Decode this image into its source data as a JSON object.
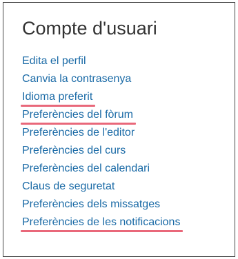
{
  "block": {
    "title": "Compte d'usuari",
    "links": [
      {
        "label": "Edita el perfil",
        "highlighted": false
      },
      {
        "label": "Canvia la contrasenya",
        "highlighted": false
      },
      {
        "label": "Idioma preferit",
        "highlighted": true
      },
      {
        "label": "Preferències del fòrum",
        "highlighted": true
      },
      {
        "label": "Preferències de l'editor",
        "highlighted": false
      },
      {
        "label": "Preferències del curs",
        "highlighted": false
      },
      {
        "label": "Preferències del calendari",
        "highlighted": false
      },
      {
        "label": "Claus de seguretat",
        "highlighted": false
      },
      {
        "label": "Preferències dels missatges",
        "highlighted": false
      },
      {
        "label": "Preferències de les notificacions",
        "highlighted": true
      }
    ]
  },
  "colors": {
    "link": "#1a6aa6",
    "highlight_underline": "#e9687a",
    "title": "#333333",
    "border": "#444444"
  }
}
